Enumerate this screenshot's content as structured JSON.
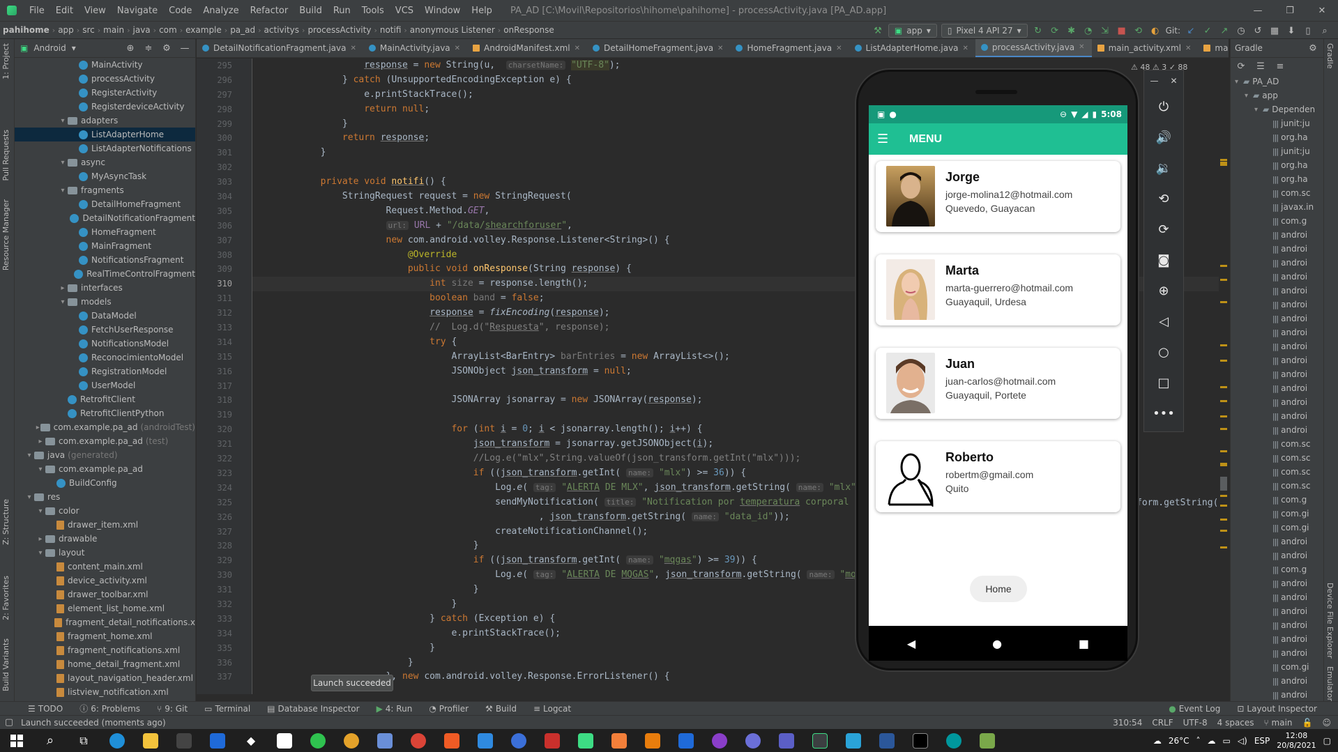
{
  "menubar": {
    "items": [
      "File",
      "Edit",
      "View",
      "Navigate",
      "Code",
      "Analyze",
      "Refactor",
      "Build",
      "Run",
      "Tools",
      "VCS",
      "Window",
      "Help"
    ],
    "window_title": "PA_AD [C:\\Movil\\Repositorios\\hihome\\pahihome] - processActivity.java [PA_AD.app]"
  },
  "breadcrumb": [
    "pahihome",
    "app",
    "src",
    "main",
    "java",
    "com",
    "example",
    "pa_ad",
    "activitys",
    "processActivity",
    "notifi",
    "anonymous Listener",
    "onResponse"
  ],
  "toolbar": {
    "run_config": "app",
    "device": "Pixel 4 API 27",
    "git_label": "Git:"
  },
  "project_panel": {
    "title": "Android",
    "rows": [
      {
        "label": "MainActivity",
        "indent": 5,
        "kind": "class"
      },
      {
        "label": "processActivity",
        "indent": 5,
        "kind": "class"
      },
      {
        "label": "RegisterActivity",
        "indent": 5,
        "kind": "class"
      },
      {
        "label": "RegisterdeviceActivity",
        "indent": 5,
        "kind": "class"
      },
      {
        "label": "adapters",
        "indent": 4,
        "kind": "folder",
        "arrow": "▾"
      },
      {
        "label": "ListAdapterHome",
        "indent": 5,
        "kind": "class",
        "selected": true
      },
      {
        "label": "ListAdapterNotifications",
        "indent": 5,
        "kind": "class"
      },
      {
        "label": "async",
        "indent": 4,
        "kind": "folder",
        "arrow": "▾"
      },
      {
        "label": "MyAsyncTask",
        "indent": 5,
        "kind": "class"
      },
      {
        "label": "fragments",
        "indent": 4,
        "kind": "folder",
        "arrow": "▾"
      },
      {
        "label": "DetailHomeFragment",
        "indent": 5,
        "kind": "class"
      },
      {
        "label": "DetailNotificationFragment",
        "indent": 5,
        "kind": "class"
      },
      {
        "label": "HomeFragment",
        "indent": 5,
        "kind": "class"
      },
      {
        "label": "MainFragment",
        "indent": 5,
        "kind": "class"
      },
      {
        "label": "NotificationsFragment",
        "indent": 5,
        "kind": "class"
      },
      {
        "label": "RealTimeControlFragment",
        "indent": 5,
        "kind": "class"
      },
      {
        "label": "interfaces",
        "indent": 4,
        "kind": "folder",
        "arrow": "▸"
      },
      {
        "label": "models",
        "indent": 4,
        "kind": "folder",
        "arrow": "▾"
      },
      {
        "label": "DataModel",
        "indent": 5,
        "kind": "class"
      },
      {
        "label": "FetchUserResponse",
        "indent": 5,
        "kind": "class"
      },
      {
        "label": "NotificationsModel",
        "indent": 5,
        "kind": "class"
      },
      {
        "label": "ReconocimientoModel",
        "indent": 5,
        "kind": "class"
      },
      {
        "label": "RegistrationModel",
        "indent": 5,
        "kind": "class"
      },
      {
        "label": "UserModel",
        "indent": 5,
        "kind": "class"
      },
      {
        "label": "RetrofitClient",
        "indent": 4,
        "kind": "class"
      },
      {
        "label": "RetrofitClientPython",
        "indent": 4,
        "kind": "class"
      },
      {
        "label": "com.example.pa_ad",
        "suffix": "(androidTest)",
        "indent": 2,
        "kind": "folder",
        "arrow": "▸"
      },
      {
        "label": "com.example.pa_ad",
        "suffix": "(test)",
        "indent": 2,
        "kind": "folder",
        "arrow": "▸"
      },
      {
        "label": "java",
        "suffix": "(generated)",
        "indent": 1,
        "kind": "folder",
        "arrow": "▾"
      },
      {
        "label": "com.example.pa_ad",
        "indent": 2,
        "kind": "folder",
        "arrow": "▾"
      },
      {
        "label": "BuildConfig",
        "indent": 3,
        "kind": "class"
      },
      {
        "label": "res",
        "indent": 1,
        "kind": "folder",
        "arrow": "▾"
      },
      {
        "label": "color",
        "indent": 2,
        "kind": "folder",
        "arrow": "▾"
      },
      {
        "label": "drawer_item.xml",
        "indent": 3,
        "kind": "file"
      },
      {
        "label": "drawable",
        "indent": 2,
        "kind": "folder",
        "arrow": "▸"
      },
      {
        "label": "layout",
        "indent": 2,
        "kind": "folder",
        "arrow": "▾"
      },
      {
        "label": "content_main.xml",
        "indent": 3,
        "kind": "file"
      },
      {
        "label": "device_activity.xml",
        "indent": 3,
        "kind": "file"
      },
      {
        "label": "drawer_toolbar.xml",
        "indent": 3,
        "kind": "file"
      },
      {
        "label": "element_list_home.xml",
        "indent": 3,
        "kind": "file"
      },
      {
        "label": "fragment_detail_notifications.x",
        "indent": 3,
        "kind": "file"
      },
      {
        "label": "fragment_home.xml",
        "indent": 3,
        "kind": "file"
      },
      {
        "label": "fragment_notifications.xml",
        "indent": 3,
        "kind": "file"
      },
      {
        "label": "home_detail_fragment.xml",
        "indent": 3,
        "kind": "file"
      },
      {
        "label": "layout_navigation_header.xml",
        "indent": 3,
        "kind": "file"
      },
      {
        "label": "listview_notification.xml",
        "indent": 3,
        "kind": "file"
      }
    ]
  },
  "left_strip": [
    "1: Project",
    "Pull Requests",
    "Resource Manager",
    "Z: Structure",
    "2: Favorites",
    "Build Variants"
  ],
  "editor_tabs": [
    {
      "label": "DetailNotificationFragment.java",
      "kind": "java"
    },
    {
      "label": "MainActivity.java",
      "kind": "java"
    },
    {
      "label": "AndroidManifest.xml",
      "kind": "xml"
    },
    {
      "label": "DetailHomeFragment.java",
      "kind": "java"
    },
    {
      "label": "HomeFragment.java",
      "kind": "java"
    },
    {
      "label": "ListAdapterHome.java",
      "kind": "java"
    },
    {
      "label": "processActivity.java",
      "kind": "java",
      "active": true
    },
    {
      "label": "main_activity.xml",
      "kind": "xml"
    },
    {
      "label": "main_fragment.xr",
      "kind": "xml"
    }
  ],
  "editor": {
    "line_numbers": [
      "295",
      "296",
      "297",
      "298",
      "299",
      "300",
      "301",
      "302",
      "303",
      "304",
      "305",
      "306",
      "307",
      "308",
      "309",
      "310",
      "311",
      "312",
      "313",
      "314",
      "315",
      "316",
      "317",
      "318",
      "319",
      "320",
      "321",
      "322",
      "323",
      "324",
      "325",
      "326",
      "327",
      "328",
      "329",
      "330",
      "331",
      "332",
      "333",
      "334",
      "335",
      "336",
      "337"
    ],
    "current_line": "310",
    "warnings_indicator": "⚠ 48  ⚠ 3  ✓ 88",
    "right_peek": "form.getString("
  },
  "launch_popup": "Launch succeeded",
  "emulator": {
    "status_time": "5:08",
    "app_title": "MENU",
    "contacts": [
      {
        "name": "Jorge",
        "email": "jorge-molina12@hotmail.com",
        "city": "Quevedo, Guayacan",
        "photo": "man-suit"
      },
      {
        "name": "Marta",
        "email": "marta-guerrero@hotmail.com",
        "city": "Guayaquil, Urdesa",
        "photo": "woman-blonde"
      },
      {
        "name": "Juan",
        "email": "juan-carlos@hotmail.com",
        "city": "Guayaquil, Portete",
        "photo": "man-smile"
      },
      {
        "name": "Roberto",
        "email": "robertm@gmail.com",
        "city": "Quito",
        "photo": "person-silhouette"
      }
    ],
    "home_button": "Home"
  },
  "emulator_panel": [
    "power-icon",
    "volume-up-icon",
    "volume-down-icon",
    "rotate-left-icon",
    "rotate-right-icon",
    "camera-icon",
    "zoom-icon",
    "back-icon",
    "home-icon",
    "overview-icon",
    "more-icon"
  ],
  "gradle": {
    "title": "Gradle",
    "root": "PA_AD",
    "app": "app",
    "deps": "Dependen",
    "items": [
      "junit:ju",
      "org.ha",
      "junit:ju",
      "org.ha",
      "org.ha",
      "com.sc",
      "javax.in",
      "com.g",
      "androi",
      "androi",
      "androi",
      "androi",
      "androi",
      "androi",
      "androi",
      "androi",
      "androi",
      "androi",
      "androi",
      "androi",
      "androi",
      "androi",
      "androi",
      "com.sc",
      "com.sc",
      "com.sc",
      "com.sc",
      "com.g",
      "com.gi",
      "com.gi",
      "androi",
      "androi",
      "com.g",
      "androi",
      "androi",
      "androi",
      "androi",
      "androi",
      "androi",
      "com.gi",
      "androi",
      "androi",
      "androi"
    ]
  },
  "right_strip": [
    "Gradle",
    "Device File Explorer",
    "Emulator"
  ],
  "bottom_tools": [
    "TODO",
    "6: Problems",
    "9: Git",
    "Terminal",
    "Database Inspector",
    "4: Run",
    "Profiler",
    "Build",
    "Logcat"
  ],
  "bottom_right_tools": [
    "Event Log",
    "Layout Inspector"
  ],
  "status": {
    "message": "Launch succeeded (moments ago)",
    "position": "310:54",
    "line_sep": "CRLF",
    "encoding": "UTF-8",
    "indent": "4 spaces",
    "branch": "main"
  },
  "taskbar": {
    "temperature": "26°C",
    "lang": "ESP",
    "time": "12:08",
    "date": "20/8/2021"
  }
}
